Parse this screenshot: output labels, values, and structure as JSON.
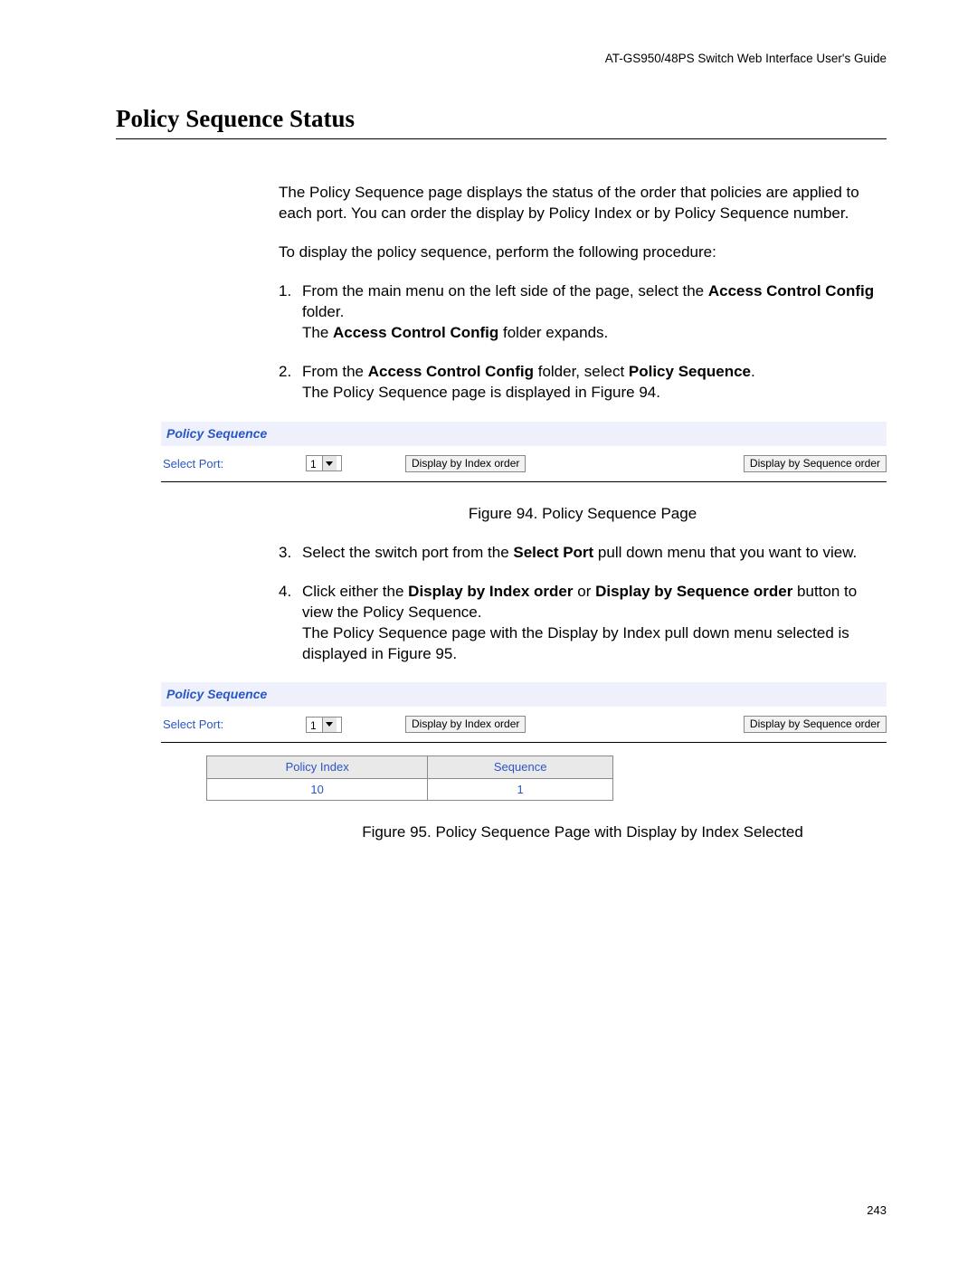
{
  "header": {
    "guide": "AT-GS950/48PS Switch Web Interface User's Guide"
  },
  "title": "Policy Sequence Status",
  "intro1": "The Policy Sequence page displays the status of the order that policies are applied to each port. You can order the display by Policy Index or by Policy Sequence number.",
  "intro2": "To display the policy sequence, perform the following procedure:",
  "steps": {
    "s1_prefix": "From the main menu on the left side of the page, select the ",
    "s1_bold1": "Access Control Config",
    "s1_after1": " folder.",
    "s1_line2_pre": "The ",
    "s1_line2_bold": "Access Control Config",
    "s1_line2_post": " folder expands.",
    "s2_pre": "From the ",
    "s2_bold1": "Access Control Config",
    "s2_mid": " folder, select ",
    "s2_bold2": "Policy Sequence",
    "s2_end": ".",
    "s2_line2": "The Policy Sequence page is displayed in Figure 94.",
    "s3_pre": "Select the switch port from the ",
    "s3_bold": "Select Port",
    "s3_post": " pull down menu that you want to view.",
    "s4_pre": "Click either the ",
    "s4_bold1": "Display by Index order",
    "s4_mid": " or ",
    "s4_bold2": "Display by Sequence order",
    "s4_post": " button to view the Policy Sequence.",
    "s4_line2": "The Policy Sequence page with the Display by Index pull down menu selected is displayed in Figure 95."
  },
  "widget": {
    "title": "Policy Sequence",
    "select_label": "Select Port:",
    "select_value": "1",
    "btn_index": "Display by Index order",
    "btn_seq": "Display by Sequence order"
  },
  "fig94": "Figure 94. Policy Sequence Page",
  "fig95": "Figure 95. Policy Sequence Page with Display by Index Selected",
  "table": {
    "col1": "Policy Index",
    "col2": "Sequence",
    "v1": "10",
    "v2": "1"
  },
  "page_number": "243"
}
